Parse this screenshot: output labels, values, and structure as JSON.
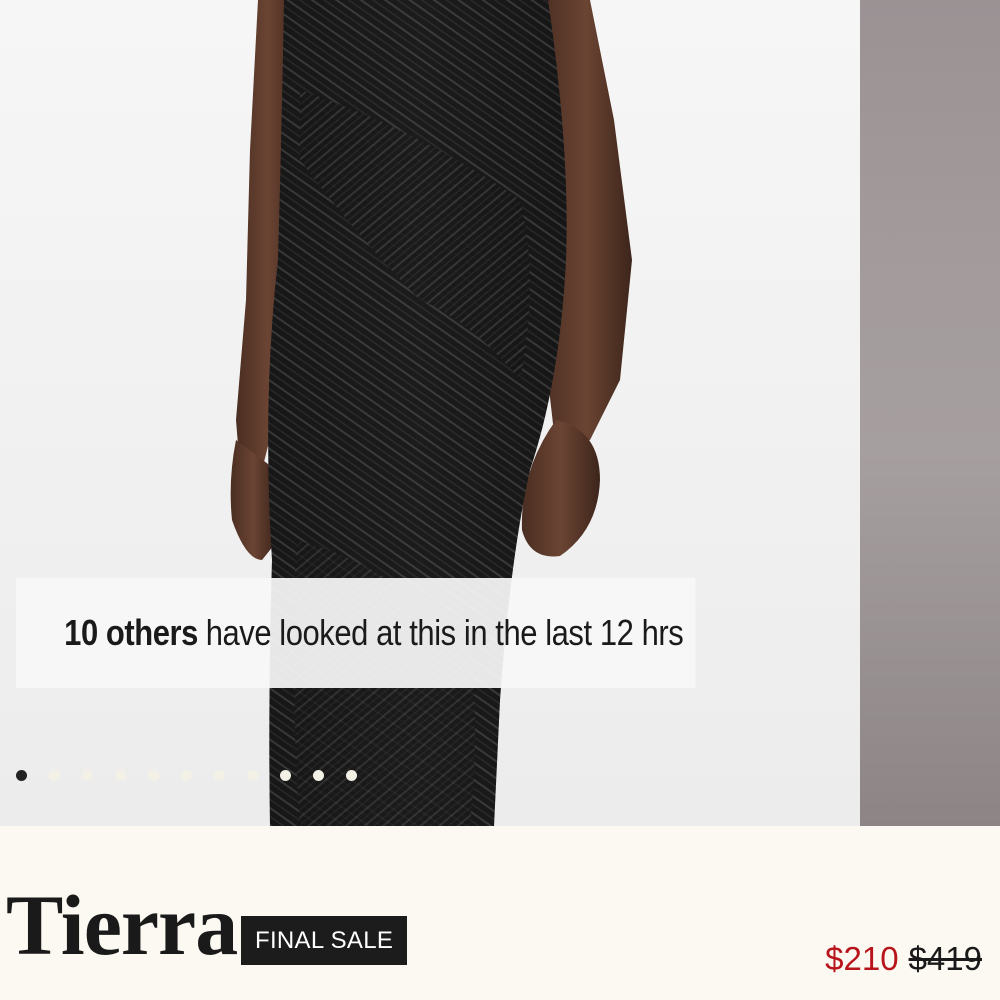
{
  "gallery": {
    "image_alt": "Model wearing black sequin gown",
    "proof_count": "10 others",
    "proof_rest": "have looked at this in the last 12 hrs",
    "dots_total": 11,
    "dots_active_index": 0
  },
  "product": {
    "name": "Tierra",
    "badge": "FINAL SALE",
    "sale_price": "$210",
    "original_price": "$419"
  },
  "colors": {
    "sale_price": "#b8141c",
    "badge_bg": "#1c1c1c",
    "page_bg": "#fbf9f1"
  }
}
